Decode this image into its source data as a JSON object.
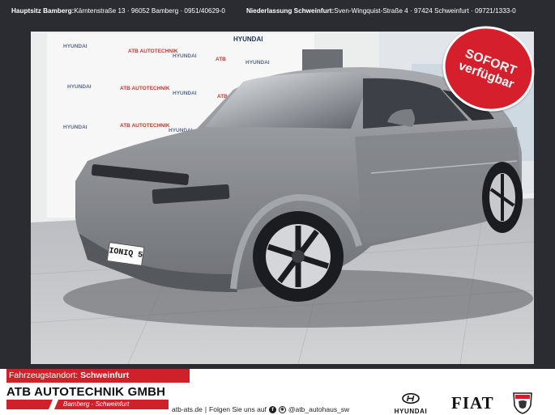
{
  "topbar": {
    "hq_label": "Hauptsitz Bamberg:",
    "hq_address": " Kärntenstraße 13 · 96052 Bamberg · 0951/40629-0",
    "branch_label": "Niederlassung Schweinfurt:",
    "branch_address": " Sven-Wingquist-Straße 4 · 97424 Schweinfurt · 09721/1333-0"
  },
  "photo": {
    "wall_brand": "HYUNDAI",
    "plate_text": "IONIQ 5",
    "sticker_line1": "SOFORT",
    "sticker_line2": "verfügbar"
  },
  "footer": {
    "location_label": "Fahrzeugstandort:",
    "location_value": " Schweinfurt",
    "company_name": "ATB AUTOTECHNIK GMBH",
    "company_cities": "Bamberg - Schweinfurt",
    "website": "atb-ats.de",
    "separator": "|",
    "follow_text": "Folgen Sie uns auf",
    "social_handle": "@atb_autohaus_sw",
    "brand_hyundai": "HYUNDAI",
    "brand_fiat": "FIAT"
  },
  "colors": {
    "frame": "#2b2c31",
    "accent_red": "#d0202a",
    "car_body": "#8c8f93"
  },
  "icons": {
    "facebook": "facebook-icon",
    "instagram": "instagram-icon",
    "hyundai_logo": "hyundai-logo-icon",
    "abarth_logo": "abarth-scorpion-icon"
  }
}
